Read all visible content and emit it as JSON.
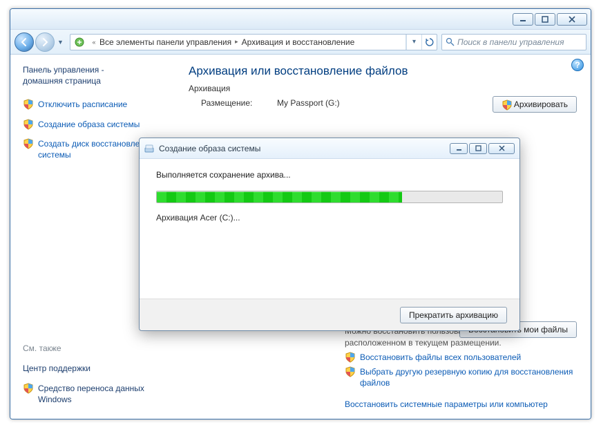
{
  "window": {
    "min_tip": "Свернуть",
    "max_tip": "Развернуть",
    "close_tip": "Закрыть"
  },
  "nav": {
    "crumb_root": "Все элементы панели управления",
    "crumb_current": "Архивация и восстановление",
    "search_placeholder": "Поиск в панели управления"
  },
  "sidebar": {
    "home_line1": "Панель управления -",
    "home_line2": "домашняя страница",
    "items": [
      {
        "label": "Отключить расписание"
      },
      {
        "label": "Создание образа системы"
      },
      {
        "label": "Создать диск восстановления системы"
      }
    ],
    "see_also": "См. также",
    "footer": [
      {
        "label": "Центр поддержки",
        "shield": false
      },
      {
        "label": "Средство переноса данных Windows",
        "shield": true
      }
    ]
  },
  "main": {
    "title": "Архивация или восстановление файлов",
    "section_backup": "Архивация",
    "placement_label": "Размещение:",
    "placement_value": "My Passport (G:)",
    "backup_now": "Архивировать",
    "restore_desc1": "Можно восстановить пользовательские файлы из архива,",
    "restore_desc2": "расположенном в текущем размещении.",
    "restore_link1": "Восстановить файлы всех пользователей",
    "restore_link2": "Выбрать другую резервную копию для восстановления файлов",
    "restore_sys": "Восстановить системные параметры или компьютер",
    "restore_my_files": "Восстановить мои файлы"
  },
  "dialog": {
    "title": "Создание образа системы",
    "status": "Выполняется сохранение архива...",
    "detail": "Архивация Acer (C:)...",
    "cancel": "Прекратить архивацию",
    "progress_percent": 71
  }
}
